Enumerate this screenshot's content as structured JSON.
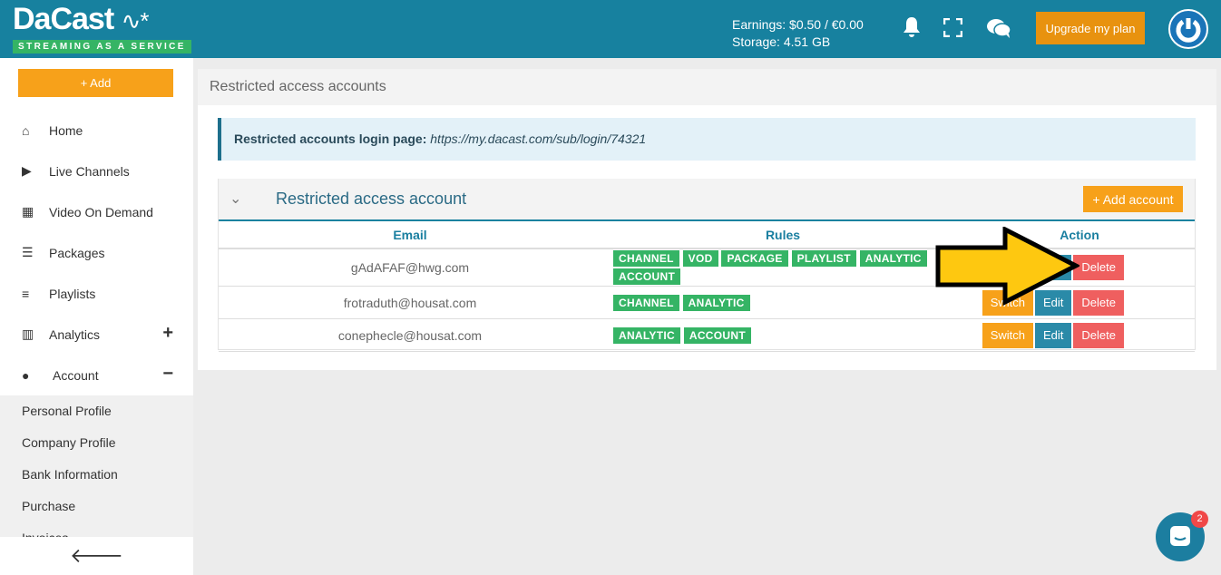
{
  "header": {
    "logo": "DaCast",
    "tagline": "STREAMING AS A SERVICE",
    "earnings": "Earnings: $0.50 / €0.00",
    "storage": "Storage: 4.51 GB",
    "upgrade": "Upgrade my plan"
  },
  "sidebar": {
    "add": "+ Add",
    "items": [
      {
        "label": "Home",
        "icon": "home-icon"
      },
      {
        "label": "Live Channels",
        "icon": "play-circle-icon"
      },
      {
        "label": "Video On Demand",
        "icon": "film-icon"
      },
      {
        "label": "Packages",
        "icon": "packages-icon"
      },
      {
        "label": "Playlists",
        "icon": "playlist-add-icon"
      },
      {
        "label": "Analytics",
        "icon": "bar-chart-icon",
        "toggle": "+"
      },
      {
        "label": "Account",
        "icon": "user-icon",
        "toggle": "−"
      }
    ],
    "account_sub": [
      "Personal Profile",
      "Company Profile",
      "Bank Information",
      "Purchase",
      "Invoices"
    ]
  },
  "main": {
    "title": "Restricted access accounts",
    "info_label": "Restricted accounts login page:",
    "info_url": "https://my.dacast.com/sub/login/74321",
    "panel_title": "Restricted access account",
    "add_account": "+ Add account",
    "columns": [
      "Email",
      "Rules",
      "Action"
    ],
    "rows": [
      {
        "email": "gAdAFAF@hwg.com",
        "rules": [
          "CHANNEL",
          "VOD",
          "PACKAGE",
          "PLAYLIST",
          "ANALYTIC",
          "ACCOUNT"
        ]
      },
      {
        "email": "frotraduth@housat.com",
        "rules": [
          "CHANNEL",
          "ANALYTIC"
        ]
      },
      {
        "email": "conephecle@housat.com",
        "rules": [
          "ANALYTIC",
          "ACCOUNT"
        ]
      }
    ],
    "actions": {
      "switch": "Switch",
      "edit": "Edit",
      "delete": "Delete"
    }
  },
  "chat": {
    "badge": "2"
  },
  "colors": {
    "header": "#17819f",
    "accent": "#f7a11a",
    "tag": "#35b465",
    "delete": "#ef5f5f",
    "edit": "#2a8aa8",
    "annotation_arrow": "#fec810"
  }
}
